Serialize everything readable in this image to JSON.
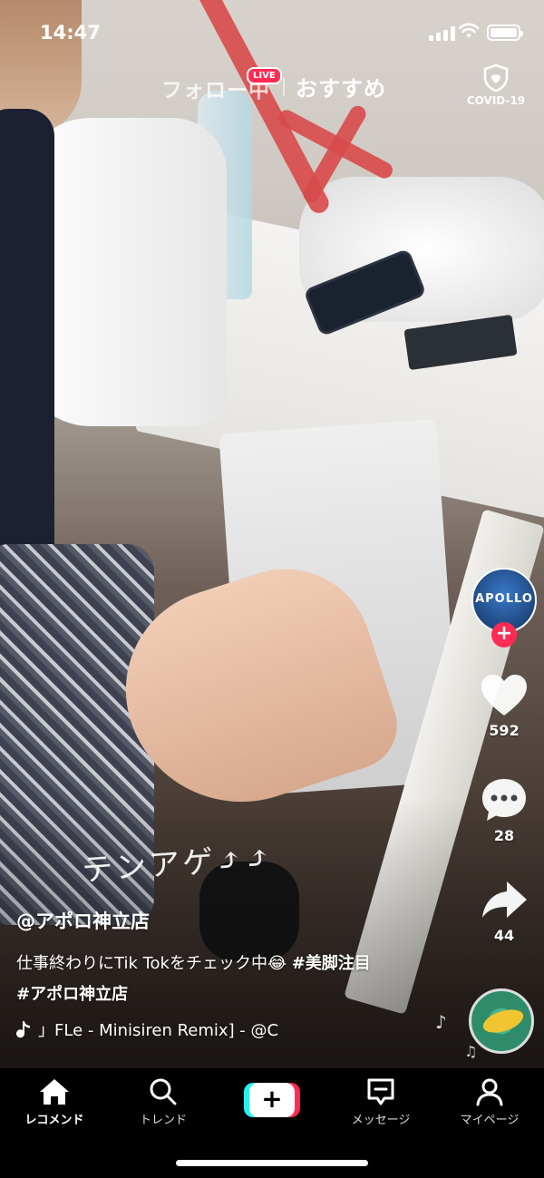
{
  "status_bar": {
    "time": "14:47"
  },
  "top_tabs": {
    "following": "フォロー中",
    "live_badge": "LIVE",
    "recommended": "おすすめ",
    "covid_label": "COVID-19"
  },
  "video_overlay_text": "テンアゲ⤴⤴",
  "creator": {
    "avatar_text": "APOLLO"
  },
  "actions": {
    "likes": "592",
    "comments": "28",
    "shares": "44"
  },
  "caption": {
    "username": "@アポロ神立店",
    "text_before": "仕事終わりにTik Tokをチェック中😂 ",
    "tag1": "#美脚注目",
    "tag2": "#アポロ神立店",
    "sound": "」FLe - Minisiren Remix] - @C"
  },
  "bottom_nav": {
    "home": "レコメンド",
    "trend": "トレンド",
    "create": "+",
    "messages": "メッセージ",
    "me": "マイページ"
  },
  "colors": {
    "accent_red": "#fe2c55",
    "accent_cyan": "#25f4ee",
    "nav_background": "#000000"
  },
  "icons": [
    "heart-icon",
    "comment-icon",
    "share-icon",
    "shield-icon",
    "home-icon",
    "search-icon",
    "message-icon",
    "person-icon",
    "music-note-icon"
  ]
}
